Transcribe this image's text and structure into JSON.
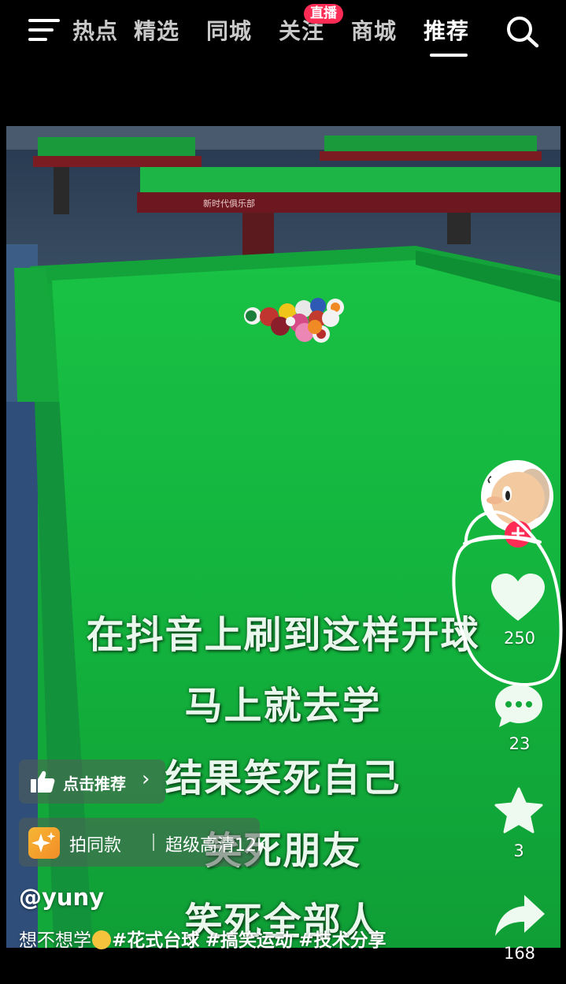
{
  "nav": {
    "tabs": [
      {
        "label": "热点"
      },
      {
        "label": "精选"
      },
      {
        "label": "同城"
      },
      {
        "label": "关注"
      },
      {
        "label": "商城"
      },
      {
        "label": "推荐"
      }
    ],
    "active_tab": "推荐",
    "live_badge": "直播",
    "icons": [
      "menu-icon",
      "search-icon"
    ]
  },
  "video": {
    "captions": [
      "在抖音上刷到这样开球",
      "马上就去学",
      "结果笑死自己",
      "笑死朋友",
      "笑死全部人"
    ],
    "table_brand": "新时代俱乐部"
  },
  "rail": {
    "like_count": "250",
    "comment_count": "23",
    "favorite_count": "3",
    "share_count": "168",
    "follow_label": "+"
  },
  "overlay": {
    "recommend_label": "点击推荐",
    "recommend_chevron": "›",
    "effect_label": "拍同款",
    "effect_quality": "超级高清12K"
  },
  "post": {
    "username": "@yuny",
    "desc_prefix": "想不想学",
    "tags": [
      "#花式台球",
      "#搞笑运动",
      "#技术分享"
    ]
  },
  "colors": {
    "accent": "#fe2c55",
    "felt": "#14b13f",
    "annotation": "#ffffff"
  }
}
